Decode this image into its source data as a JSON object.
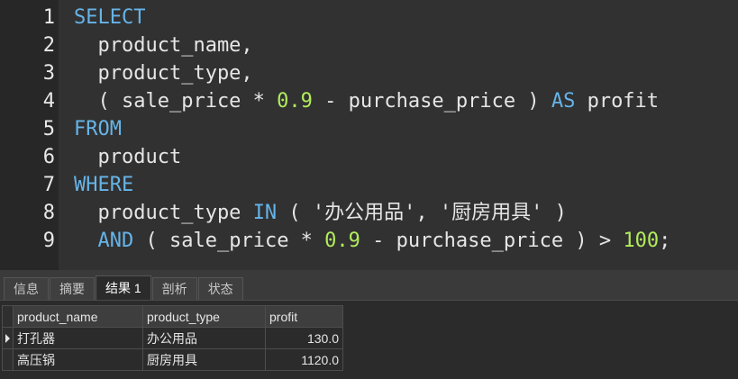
{
  "editor": {
    "line_numbers": [
      "1",
      "2",
      "3",
      "4",
      "5",
      "6",
      "7",
      "8",
      "9"
    ],
    "lines": [
      [
        {
          "t": "SELECT",
          "c": "kw"
        }
      ],
      [
        {
          "t": "  product_name,",
          "c": "id"
        }
      ],
      [
        {
          "t": "  product_type,",
          "c": "id"
        }
      ],
      [
        {
          "t": "  ( sale_price * ",
          "c": "id"
        },
        {
          "t": "0.9",
          "c": "num"
        },
        {
          "t": " - purchase_price ) ",
          "c": "id"
        },
        {
          "t": "AS",
          "c": "kw"
        },
        {
          "t": " profit",
          "c": "id"
        }
      ],
      [
        {
          "t": "FROM",
          "c": "kw"
        }
      ],
      [
        {
          "t": "  product",
          "c": "id"
        }
      ],
      [
        {
          "t": "WHERE",
          "c": "kw"
        }
      ],
      [
        {
          "t": "  product_type ",
          "c": "id"
        },
        {
          "t": "IN",
          "c": "kw"
        },
        {
          "t": " ( '办公用品', '厨房用具' )",
          "c": "str"
        }
      ],
      [
        {
          "t": "  ",
          "c": "id"
        },
        {
          "t": "AND",
          "c": "kw"
        },
        {
          "t": " ( sale_price * ",
          "c": "id"
        },
        {
          "t": "0.9",
          "c": "num"
        },
        {
          "t": " - purchase_price ) > ",
          "c": "id"
        },
        {
          "t": "100",
          "c": "num"
        },
        {
          "t": ";",
          "c": "id"
        }
      ]
    ]
  },
  "tabs": [
    {
      "label": "信息",
      "active": false
    },
    {
      "label": "摘要",
      "active": false
    },
    {
      "label": "结果 1",
      "active": true
    },
    {
      "label": "剖析",
      "active": false
    },
    {
      "label": "状态",
      "active": false
    }
  ],
  "result": {
    "columns": [
      "product_name",
      "product_type",
      "profit"
    ],
    "rows": [
      {
        "product_name": "打孔器",
        "product_type": "办公用品",
        "profit": "130.0",
        "current": true
      },
      {
        "product_name": "高压锅",
        "product_type": "厨房用具",
        "profit": "1120.0",
        "current": false
      }
    ]
  },
  "colors": {
    "keyword": "#66b4e8",
    "number": "#b2ec5d",
    "text": "#e6e6e6",
    "editor_bg": "#313131"
  }
}
